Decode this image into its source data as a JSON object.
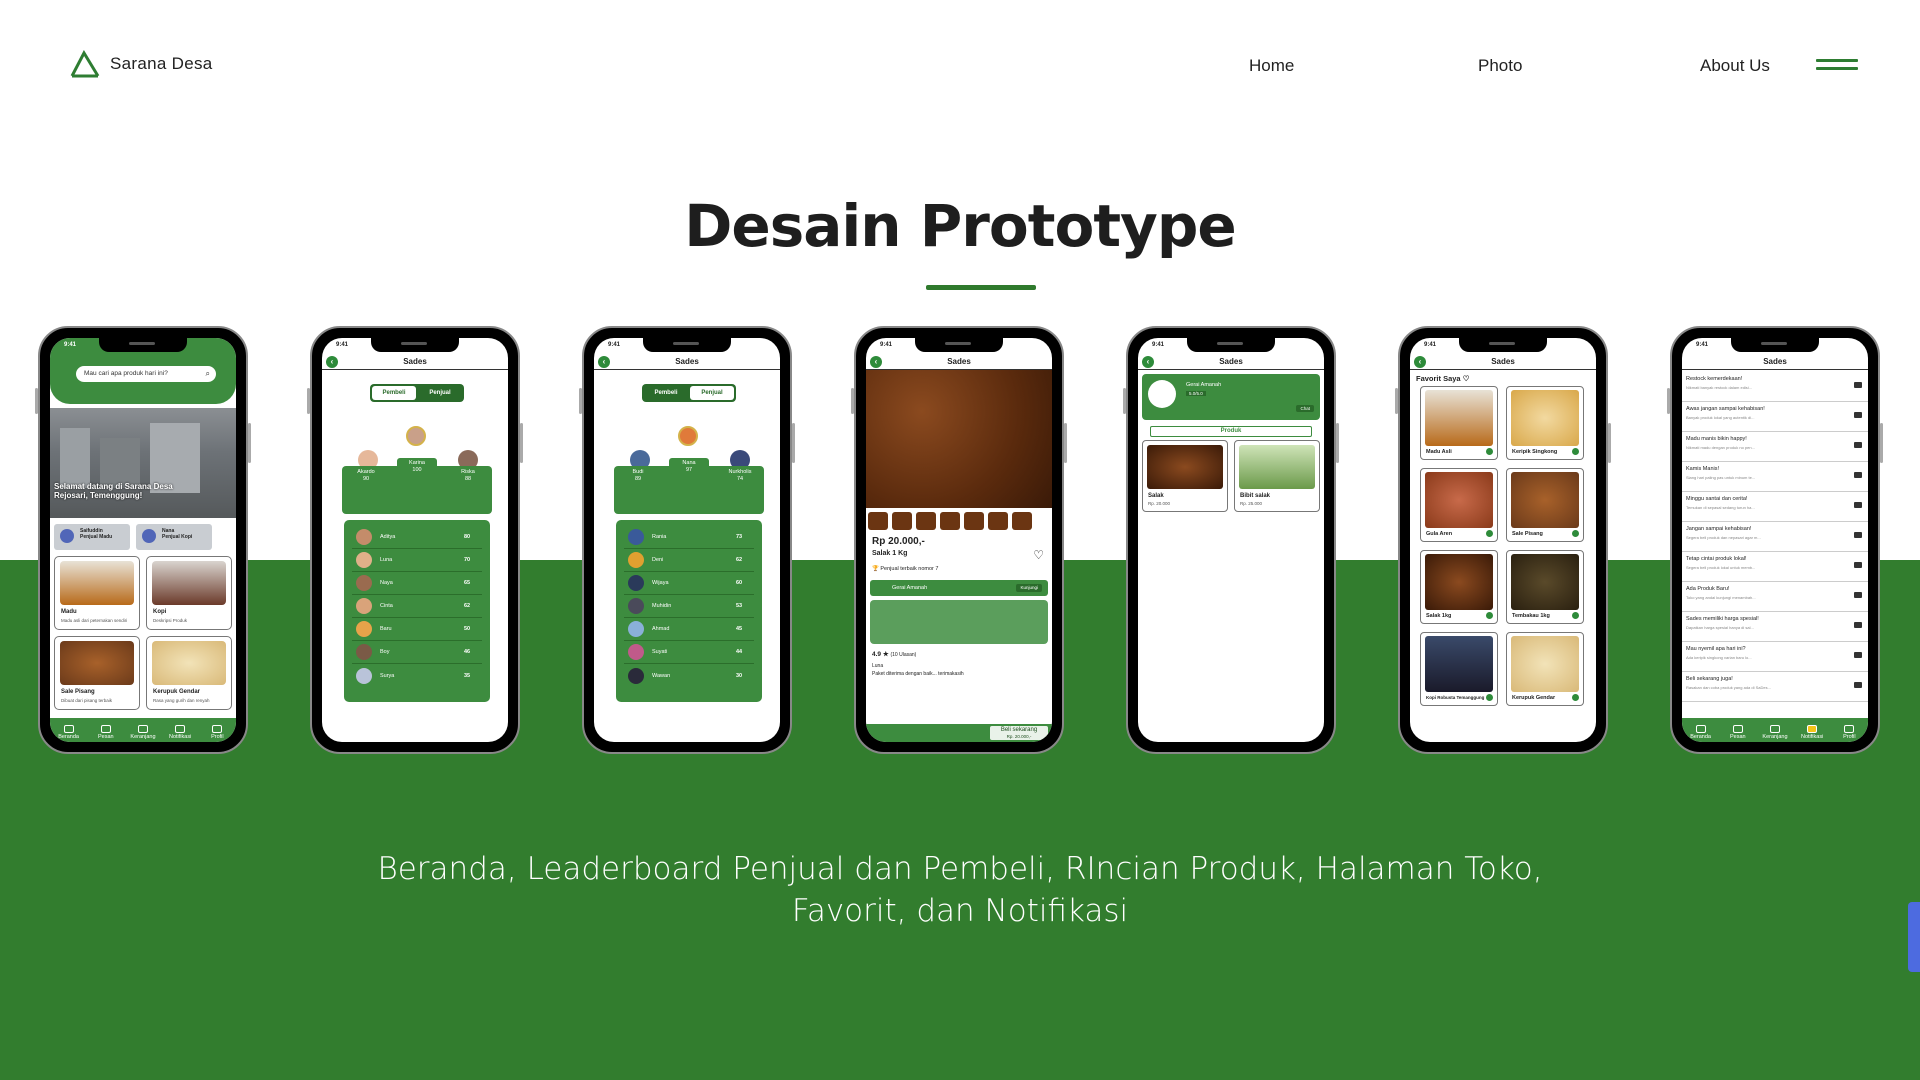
{
  "header": {
    "brand": "Sarana  Desa",
    "nav": [
      "Home",
      "Photo",
      "About Us"
    ]
  },
  "title": "Desain Prototype",
  "caption": "Beranda, Leaderboard Penjual dan Pembeli, RIncian Produk, Halaman Toko, Favorit, dan Notifikasi",
  "colors": {
    "brand_green": "#327d2e",
    "accent_green": "#3d8c3f",
    "scroll_tab": "#4d6be0"
  },
  "phones": {
    "status_time": "9:41",
    "app_title": "Sades",
    "beranda": {
      "search_placeholder": "Mau cari apa produk hari ini?",
      "welcome": "Selamat datang di Sarana Desa Rejosari, Temenggung!",
      "sellers": [
        {
          "name": "Saifuddin",
          "role": "Penjual Madu"
        },
        {
          "name": "Nana",
          "role": "Penjual Kopi"
        }
      ],
      "products": [
        {
          "name": "Madu",
          "desc": "Madu asli dari peternakan sendiri"
        },
        {
          "name": "Kopi",
          "desc": "Deskripsi Produk"
        },
        {
          "name": "Sale Pisang",
          "desc": "Dibuat dari pisang terbaik"
        },
        {
          "name": "Kerupuk Gendar",
          "desc": "Rasa yang gurih dan renyah"
        }
      ],
      "tabs": [
        "Beranda",
        "Pesan",
        "Keranjang",
        "Notifikasi",
        "Profil"
      ]
    },
    "leaderboard_pembeli": {
      "toggle": [
        "Pembeli",
        "Penjual"
      ],
      "first": {
        "name": "Karina",
        "score": "100"
      },
      "second": {
        "name": "Akardo",
        "score": "90"
      },
      "third": {
        "name": "Riska",
        "score": "88"
      },
      "rows": [
        {
          "name": "Aditya",
          "score": "80"
        },
        {
          "name": "Luna",
          "score": "70"
        },
        {
          "name": "Naya",
          "score": "65"
        },
        {
          "name": "Cinta",
          "score": "62"
        },
        {
          "name": "Baru",
          "score": "50"
        },
        {
          "name": "Boy",
          "score": "46"
        },
        {
          "name": "Surya",
          "score": "35"
        }
      ]
    },
    "leaderboard_penjual": {
      "toggle": [
        "Pembeli",
        "Penjual"
      ],
      "first": {
        "name": "Nana",
        "score": "97"
      },
      "second": {
        "name": "Budi",
        "score": "89"
      },
      "third": {
        "name": "Nurkholis",
        "score": "74"
      },
      "rows": [
        {
          "name": "Rania",
          "score": "73"
        },
        {
          "name": "Deni",
          "score": "62"
        },
        {
          "name": "Wijaya",
          "score": "60"
        },
        {
          "name": "Muhidin",
          "score": "53"
        },
        {
          "name": "Ahmad",
          "score": "45"
        },
        {
          "name": "Suyati",
          "score": "44"
        },
        {
          "name": "Wawan",
          "score": "30"
        }
      ]
    },
    "rincian": {
      "price": "Rp 20.000,-",
      "name": "Salak 1 Kg",
      "rank": "Penjual terbaik nomor 7",
      "store": "Gerai Amanah",
      "store_button": "Kunjungi",
      "rating": "4.9 ★",
      "reviews": "(10 Ulasan)",
      "reviewer": "Luna",
      "review_text": "Paket diterima dengan baik... terimakasih",
      "buy_label": "Beli sekarang",
      "buy_price": "Rp. 20.000,-"
    },
    "toko": {
      "store": "Gerai Amanah",
      "badge": "5.0/5.0",
      "chat": "Chat",
      "tab": "Produk",
      "items": [
        {
          "name": "Salak",
          "price": "Rp. 20.000"
        },
        {
          "name": "Bibit salak",
          "price": "Rp. 25.000"
        }
      ]
    },
    "favorit": {
      "title": "Favorit Saya ♡",
      "items": [
        "Madu Asli",
        "Keripik Singkong",
        "Gula Aren",
        "Sale Pisang",
        "Salak 1kg",
        "Tembakau 1kg",
        "Kopi Robusta Temanggung",
        "Kerupuk Gendar"
      ]
    },
    "notifikasi": {
      "items": [
        {
          "title": "Restock kemerdekaan!",
          "sub": "Nikmati banyak restock dalam edisi..."
        },
        {
          "title": "Awas jangan sampai kehabisan!",
          "sub": "Banyak produk lokal yang autentik di..."
        },
        {
          "title": "Madu manis bikin happy!",
          "sub": "Nikmati madu dengan produk no pen..."
        },
        {
          "title": "Kamis Manis!",
          "sub": "Siang hari paling pas untuk minum te..."
        },
        {
          "title": "Minggu santai dan cerita!",
          "sub": "Temukan di sepasal sedang turun ha..."
        },
        {
          "title": "Jangan sampai kehabisan!",
          "sub": "Segera beli produk dan nepasari agar m..."
        },
        {
          "title": "Tetap cintai produk lokal!",
          "sub": "Segera beli produk lokal untuk memb..."
        },
        {
          "title": "Ada Produk Baru!",
          "sub": "Toko yang andai kunjungi menambah..."
        },
        {
          "title": "Sades memiliki harga spesial!",
          "sub": "Dapatkan harga spesial hanya di sal..."
        },
        {
          "title": "Mau nyemil apa hari ini?",
          "sub": "Ada keripik singkong varian baru lo..."
        },
        {
          "title": "Beli sekarang juga!",
          "sub": "Rasakan dan coba produk yang ada di SaDes..."
        }
      ]
    }
  }
}
